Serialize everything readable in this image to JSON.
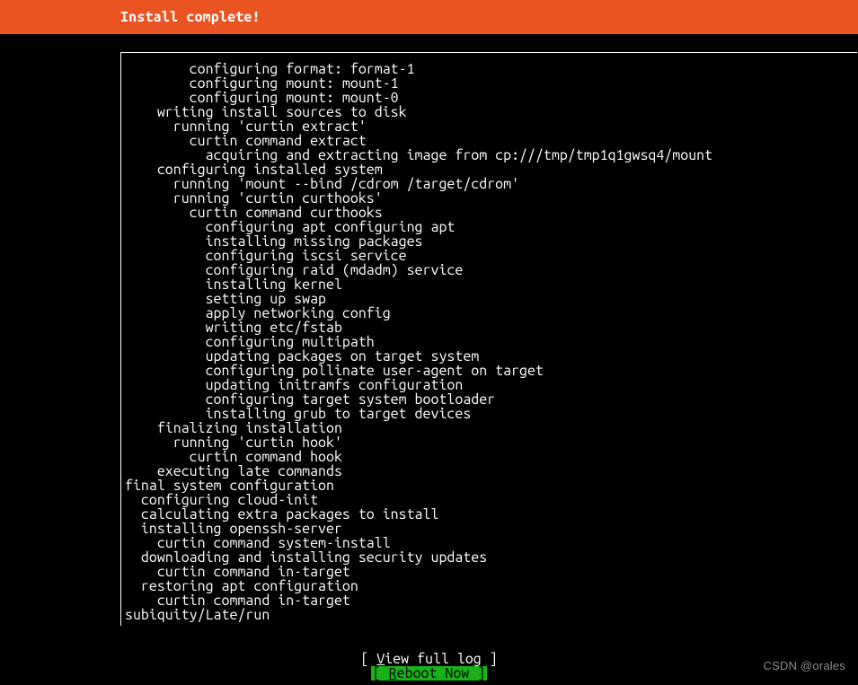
{
  "header": {
    "title": "Install complete!"
  },
  "log": {
    "lines": [
      "        configuring format: format-1",
      "        configuring mount: mount-1",
      "        configuring mount: mount-0",
      "    writing install sources to disk",
      "      running 'curtin extract'",
      "        curtin command extract",
      "          acquiring and extracting image from cp:///tmp/tmp1q1gwsq4/mount",
      "    configuring installed system",
      "      running 'mount --bind /cdrom /target/cdrom'",
      "      running 'curtin curthooks'",
      "        curtin command curthooks",
      "          configuring apt configuring apt",
      "          installing missing packages",
      "          configuring iscsi service",
      "          configuring raid (mdadm) service",
      "          installing kernel",
      "          setting up swap",
      "          apply networking config",
      "          writing etc/fstab",
      "          configuring multipath",
      "          updating packages on target system",
      "          configuring pollinate user-agent on target",
      "          updating initramfs configuration",
      "          configuring target system bootloader",
      "          installing grub to target devices",
      "    finalizing installation",
      "      running 'curtin hook'",
      "        curtin command hook",
      "    executing late commands",
      "final system configuration",
      "  configuring cloud-init",
      "  calculating extra packages to install",
      "  installing openssh-server",
      "    curtin command system-install",
      "  downloading and installing security updates",
      "    curtin command in-target",
      "  restoring apt configuration",
      "    curtin command in-target",
      "subiquity/Late/run"
    ]
  },
  "buttons": {
    "view_full_log": {
      "prefix": "[ ",
      "hotkey": "V",
      "rest": "iew full log",
      "suffix": " ]"
    },
    "reboot_now": {
      "prefix": "[ ",
      "hotkey": "R",
      "rest": "eboot Now   ",
      "suffix": " ]"
    }
  },
  "watermark": "CSDN @orales"
}
